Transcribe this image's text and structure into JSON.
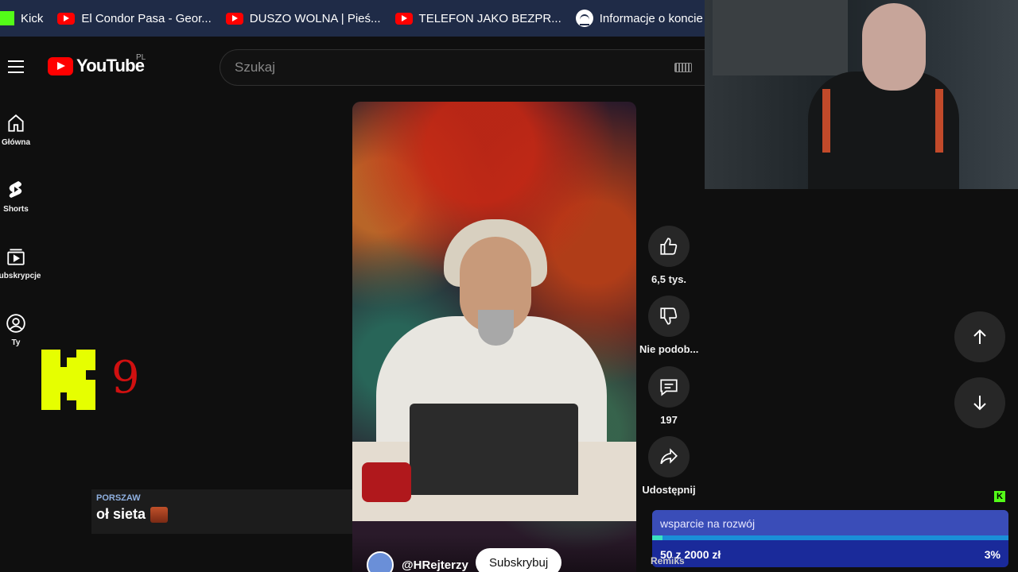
{
  "bookmarks": [
    {
      "label": "Kick",
      "icon": "kick-icon"
    },
    {
      "label": "El Condor Pasa - Geor...",
      "icon": "youtube-icon"
    },
    {
      "label": "DUSZO WOLNA | Pieś...",
      "icon": "youtube-icon"
    },
    {
      "label": "TELEFON JAKO BEZPR...",
      "icon": "youtube-icon"
    },
    {
      "label": "Informacje o koncie -",
      "icon": "spotify-icon"
    }
  ],
  "header": {
    "logo_text": "YouTube",
    "country_code": "PL",
    "search_placeholder": "Szukaj"
  },
  "sidebar": {
    "items": [
      {
        "label": "Główna",
        "icon": "home-icon"
      },
      {
        "label": "Shorts",
        "icon": "shorts-icon"
      },
      {
        "label": "Subskrypcje",
        "icon": "subscriptions-icon"
      },
      {
        "label": "Ty",
        "icon": "account-icon"
      }
    ]
  },
  "overlay": {
    "kick_count": "9"
  },
  "chat": {
    "user": "PORSZAW",
    "message": "oł sieta"
  },
  "short": {
    "channel_handle": "@HRejterzy",
    "subscribe_label": "Subskrybuj"
  },
  "actions": {
    "likes": "6,5 tys.",
    "dislike_label": "Nie podob...",
    "comments": "197",
    "share_label": "Udostępnij"
  },
  "goal": {
    "title": "wsparcie na rozwój",
    "amount": "50 z 2000 zł",
    "percent": "3%",
    "progress_fraction": 0.03,
    "remix_label": "Remiks"
  },
  "colors": {
    "youtube_red": "#ff0000",
    "kick_green": "#53fc18",
    "goal_blue": "#1a2a9a"
  }
}
